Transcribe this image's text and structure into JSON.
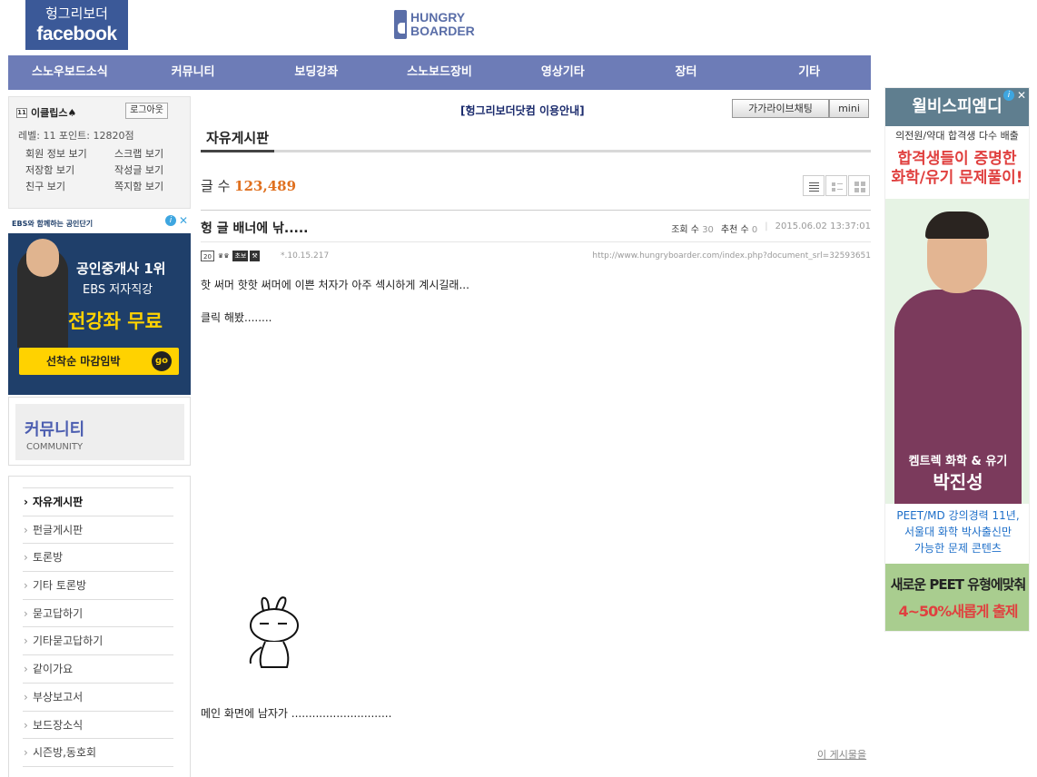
{
  "header": {
    "fb_top": "헝그리보더",
    "fb_bottom": "facebook",
    "logo_line1": "HUNGRY",
    "logo_line2": "BOARDER"
  },
  "nav": [
    "스노우보드소식",
    "커뮤니티",
    "보딩강좌",
    "스노보드장비",
    "영상기타",
    "장터",
    "기타"
  ],
  "login": {
    "level_badge": "11",
    "username": "이클립스♠",
    "logout": "로그아웃",
    "stats": "레벨: 11  포인트: 12820점",
    "links": [
      "회원 정보 보기",
      "스크랩 보기",
      "저장함 보기",
      "작성글 보기",
      "친구 보기",
      "쪽지함 보기"
    ]
  },
  "ad_left": {
    "top_text": "EBS와 함께하는 공인단기",
    "line1": "공인중개사 1위",
    "line2": "EBS 저자직강",
    "line3": "전강좌 무료",
    "cta": "선착순 마감임박",
    "go": "go"
  },
  "community": {
    "title": "커뮤니티",
    "sub": "COMMUNITY"
  },
  "menu": [
    "자유게시판",
    "펀글게시판",
    "토론방",
    "기타 토론방",
    "묻고답하기",
    "기타묻고답하기",
    "같이가요",
    "부상보고서",
    "보드장소식",
    "시즌방,동호회"
  ],
  "main": {
    "notice": "[헝그리보더닷컴 이용안내]",
    "chat_button": "가가라이브채팅",
    "mini_button": "mini",
    "board_title": "자유게시판",
    "count_label": "글 수",
    "count_value": "123,489",
    "post": {
      "title": "헝 글 배너에 낚.....",
      "views_label": "조회 수",
      "views": "30",
      "recommend_label": "추천 수",
      "recommend": "0",
      "date": "2015.06.02 13:37:01",
      "author_icons": [
        "20",
        "♛♛",
        "초보",
        "⚒"
      ],
      "ip": "*.10.15.217",
      "url": "http://www.hungryboarder.com/index.php?document_srl=32593651",
      "body1": "핫 써머 핫핫 써머에 이쁜 처자가 아주 섹시하게 계시길래...",
      "body2": "클릭 해봤........",
      "body3": "메인 화면에 남자가 .............................",
      "list_link": "이 게시물을"
    }
  },
  "ad_right": {
    "head": "윌비스피엠디",
    "sub": "의전원/약대 합격생 다수 배출",
    "red1": "합격생들이 증명한",
    "red2": "화학/유기 문제풀이!",
    "name1": "켐트렉 화학 & 유기",
    "name2": "박진성",
    "desc1": "PEET/MD 강의경력 11년,",
    "desc2": "서울대 화학 박사출신만",
    "desc3": "가능한 문제 콘텐츠",
    "b1": "새로운 PEET 유형에맞춰",
    "b2": "4~50%새롭게 출제"
  }
}
